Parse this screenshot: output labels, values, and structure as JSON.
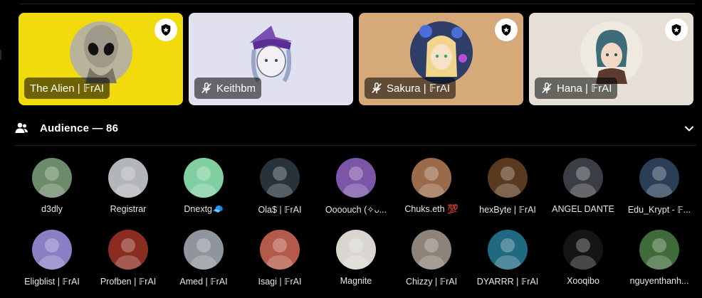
{
  "speakers": [
    {
      "name": "The Alien | 𝔽rAI",
      "bg": "#f2db0c",
      "avatar_bg": "#b9b39c",
      "moderator": true,
      "muted": false
    },
    {
      "name": "Keithbm",
      "bg": "#e1e0ee",
      "avatar_bg": "#dfe1f0",
      "moderator": false,
      "muted": true
    },
    {
      "name": "Sakura | 𝔽rAI",
      "bg": "#d5a978",
      "avatar_bg": "#3a4d7a",
      "moderator": true,
      "muted": true
    },
    {
      "name": "Hana | 𝔽rAI",
      "bg": "#e5dfd6",
      "avatar_bg": "#ebe7dc",
      "moderator": true,
      "muted": true
    }
  ],
  "audience": {
    "title": "Audience — 86",
    "members": [
      {
        "name": "d3dly",
        "color": "#6b8b6a"
      },
      {
        "name": "Registrar",
        "color": "#b2b5b9"
      },
      {
        "name": "Dnextg🧢",
        "color": "#7fcfa0"
      },
      {
        "name": "Ola$ | 𝔽rAI",
        "color": "#27323a"
      },
      {
        "name": "Oooouch (✧ᴗ...",
        "color": "#7a55a8"
      },
      {
        "name": "Chuks.eth 💯",
        "color": "#9a6a4a"
      },
      {
        "name": "hexByte | 𝔽rAI",
        "color": "#5a3a1e"
      },
      {
        "name": "ANGEL DANTE",
        "color": "#3a3d44"
      },
      {
        "name": "Edu_Krypt - 𝔽...",
        "color": "#2a3f55"
      },
      {
        "name": "Eligblist | 𝔽rAI",
        "color": "#8a7fc4"
      },
      {
        "name": "Profben | 𝔽rAI",
        "color": "#8a2d20"
      },
      {
        "name": "Amed | 𝔽rAI",
        "color": "#8f959c"
      },
      {
        "name": "Isagi | 𝔽rAI",
        "color": "#b45a4a"
      },
      {
        "name": "Magnite",
        "color": "#d9d6d0"
      },
      {
        "name": "Chizzy | 𝔽rAI",
        "color": "#8d8378"
      },
      {
        "name": "DYARRR | 𝔽rAI",
        "color": "#1f6a80"
      },
      {
        "name": "Xooqibo",
        "color": "#151515"
      },
      {
        "name": "nguyenthanh...",
        "color": "#3f6b3a"
      }
    ]
  }
}
